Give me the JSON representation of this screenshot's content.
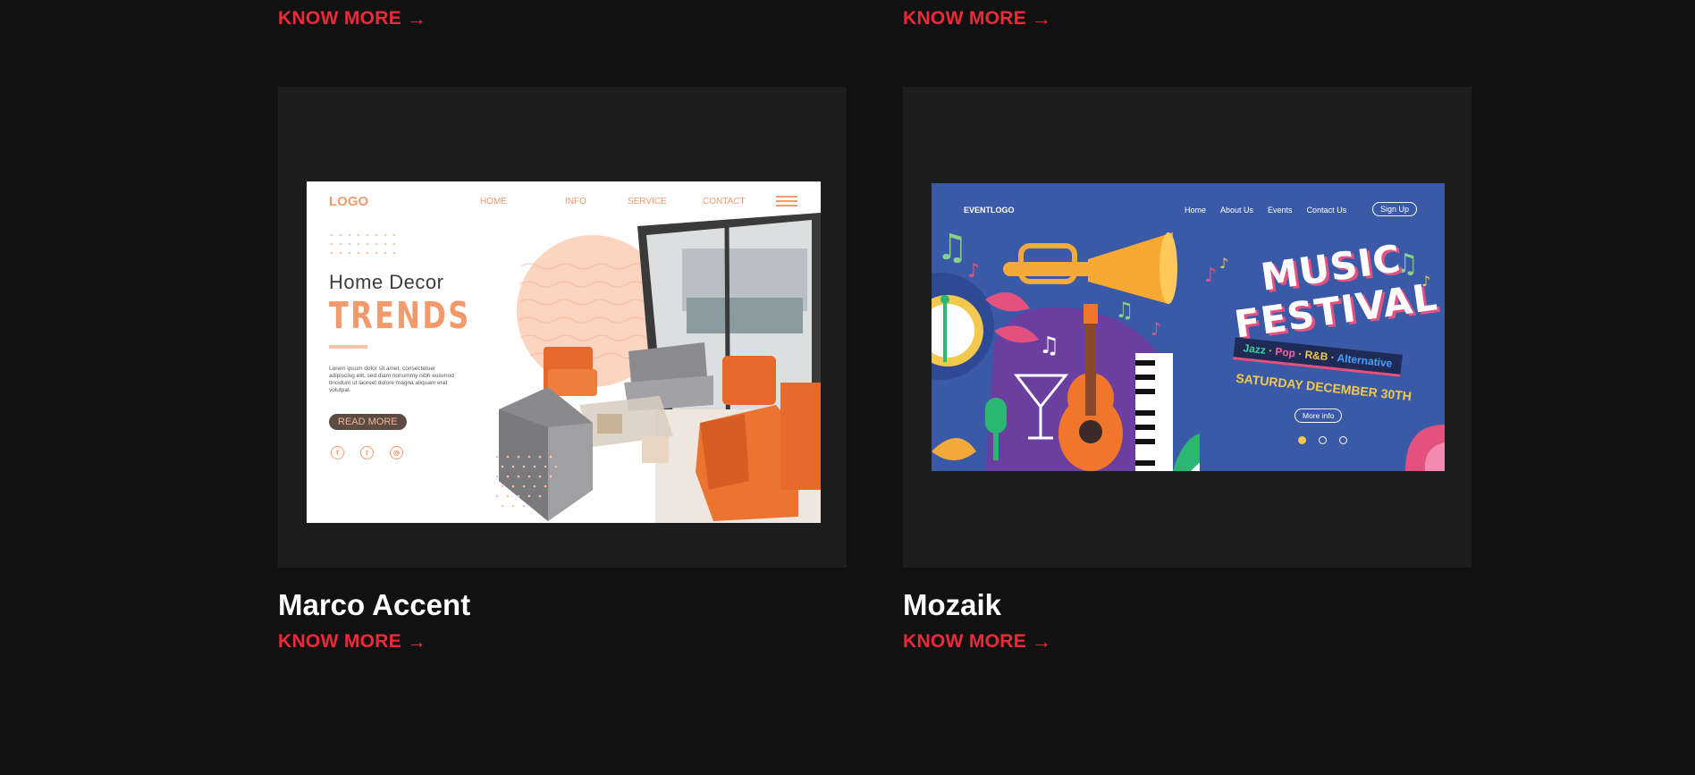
{
  "top_links": [
    {
      "label": "KNOW MORE",
      "arrow": "→"
    },
    {
      "label": "KNOW MORE",
      "arrow": "→"
    }
  ],
  "projects": [
    {
      "title": "Marco Accent",
      "link_label": "KNOW MORE",
      "arrow": "→",
      "preview": {
        "logo": "LOGO",
        "nav": [
          "HOME",
          "INFO",
          "SERVICE",
          "CONTACT"
        ],
        "heading": "Home  Decor",
        "subheading": "TRENDS",
        "paragraph": "Lorem ipsum dolor sit amet, consectetuer adipiscing elit, sed diam nonummy nibh euismod tincidunt ut laoreet dolore magna aliquam erat volutpat.",
        "button": "READ MORE",
        "social_icons": [
          "facebook-icon",
          "twitter-icon",
          "instagram-icon"
        ],
        "accent_color": "#f39a6c"
      }
    },
    {
      "title": "Mozaik",
      "link_label": "KNOW MORE",
      "arrow": "→",
      "preview": {
        "logo": "EVENTLOGO",
        "nav": [
          "Home",
          "About Us",
          "Events",
          "Contact Us"
        ],
        "signup": "Sign Up",
        "title_line1": "MUSIC",
        "title_line2": "FESTIVAL",
        "genres": [
          "Jazz",
          "Pop",
          "R&B",
          "Alternative"
        ],
        "date": "SATURDAY DECEMBER 30TH",
        "more_info": "More info",
        "background_color": "#3a5aa8"
      }
    }
  ],
  "colors": {
    "page_bg": "#111111",
    "card_bg": "#1d1d1d",
    "link": "#ee2a38",
    "title": "#ffffff"
  }
}
